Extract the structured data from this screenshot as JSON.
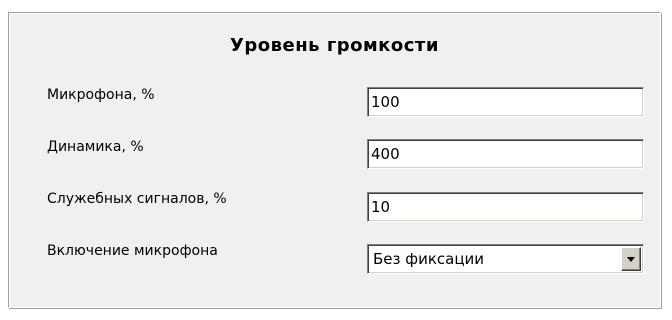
{
  "panel": {
    "title": "Уровень громкости"
  },
  "fields": [
    {
      "label": "Микрофона, %",
      "value": "100"
    },
    {
      "label": "Динамика, %",
      "value": "400"
    },
    {
      "label": "Служебных сигналов, %",
      "value": "10"
    }
  ],
  "mic_switch": {
    "label": "Включение микрофона",
    "selected": "Без фиксации"
  },
  "icons": {
    "dropdown": "chevron-down-icon"
  }
}
